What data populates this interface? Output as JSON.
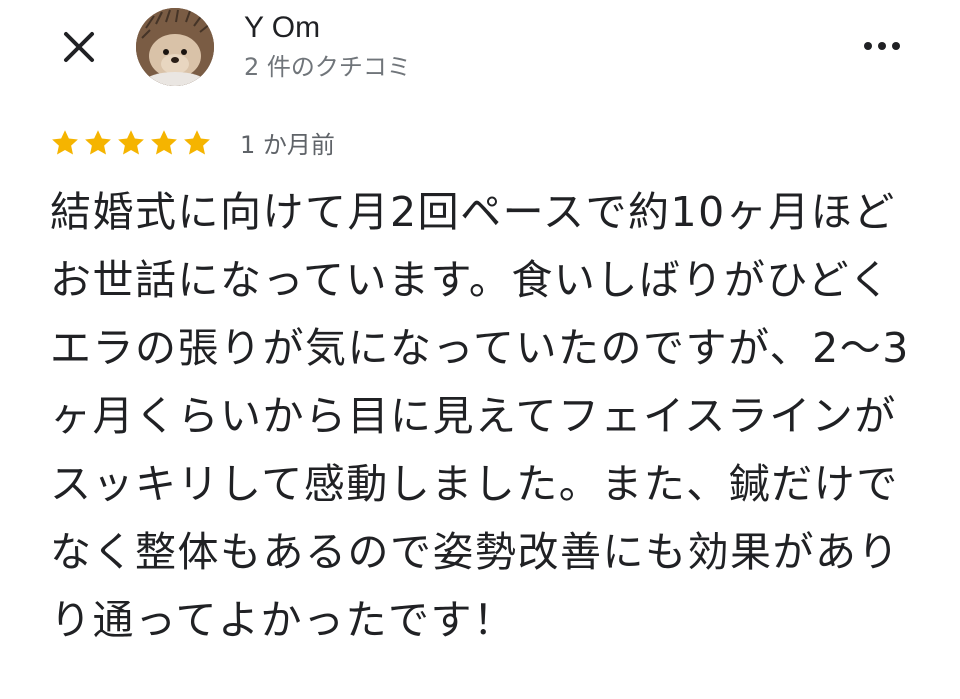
{
  "header": {
    "close_icon": "close-icon",
    "more_icon": "more-horizontal-icon"
  },
  "reviewer": {
    "name": "Y Om",
    "review_count": "2 件のクチコミ",
    "avatar": "hedgehog-photo"
  },
  "review": {
    "rating": 5,
    "rating_max": 5,
    "star_color": "#f5b400",
    "date": "1 か月前",
    "text": "結婚式に向けて月2回ペースで約10ヶ月ほどお世話になっています。食いしばりがひどくエラの張りが気になっていたのですが、2〜3ヶ月くらいから目に見えてフェイスラインがスッキリして感動しました。また、鍼だけでなく整体もあるので姿勢改善にも効果がありり通ってよかったです！"
  }
}
